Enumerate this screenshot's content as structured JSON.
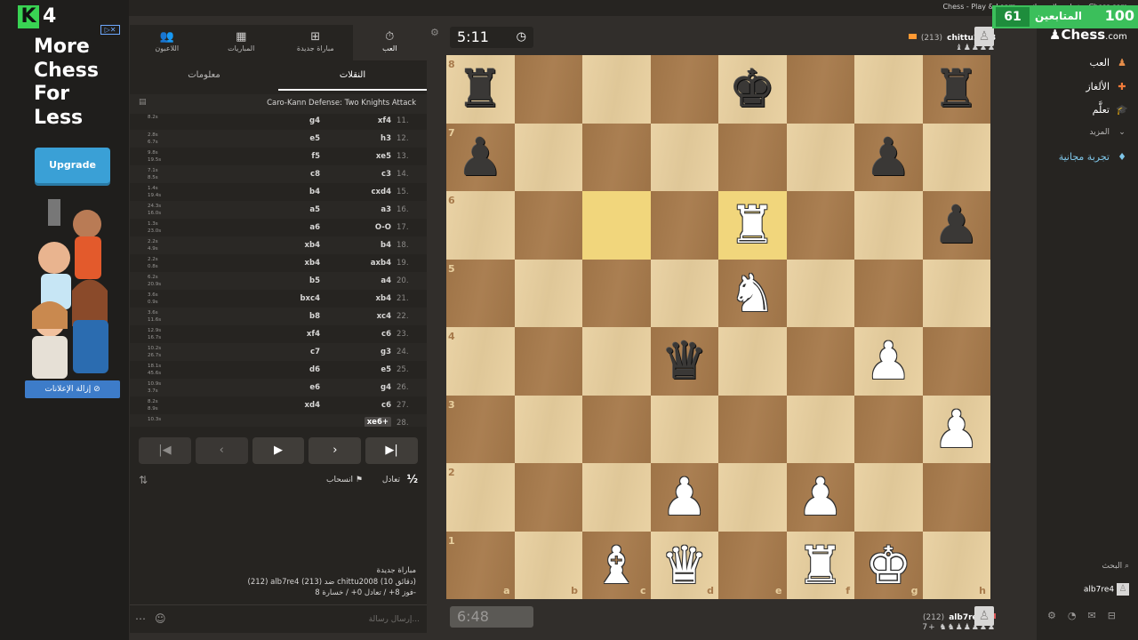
{
  "window": {
    "title": "Chess - Play & Learn - شطرنج لاعبين اثنين - Chess.com"
  },
  "ad": {
    "badge_letter": "K",
    "badge_number": "4",
    "headline": "More\nChess\nFor\nLess",
    "upgrade_label": "Upgrade",
    "remove_ads_label": "إزالة الإعلانات"
  },
  "topnav": [
    {
      "label": "العب",
      "icon": "stopwatch-icon"
    },
    {
      "label": "مباراة جديدة",
      "icon": "plus-icon"
    },
    {
      "label": "المباريات",
      "icon": "board-icon"
    },
    {
      "label": "اللاعبون",
      "icon": "people-icon"
    }
  ],
  "subtabs": [
    "النقلات",
    "معلومات"
  ],
  "opening": "Caro-Kann Defense: Two Knights Attack",
  "moves": [
    {
      "n": "11.",
      "w": "xf4",
      "b": "g4",
      "t1": "8.2s",
      "t2": ""
    },
    {
      "n": "12.",
      "w": "h3",
      "b": "e5",
      "t1": "2.8s",
      "t2": "6.7s"
    },
    {
      "n": "13.",
      "w": "xe5",
      "b": "f5",
      "t1": "9.8s",
      "t2": "19.5s"
    },
    {
      "n": "14.",
      "w": "c3",
      "b": "c8",
      "t1": "7.1s",
      "t2": "8.5s"
    },
    {
      "n": "15.",
      "w": "cxd4",
      "b": "b4",
      "t1": "1.4s",
      "t2": "19.4s"
    },
    {
      "n": "16.",
      "w": "a3",
      "b": "a5",
      "t1": "24.3s",
      "t2": "16.0s"
    },
    {
      "n": "17.",
      "w": "O-O",
      "b": "a6",
      "t1": "1.3s",
      "t2": "23.0s"
    },
    {
      "n": "18.",
      "w": "b4",
      "b": "xb4",
      "t1": "2.2s",
      "t2": "4.9s"
    },
    {
      "n": "19.",
      "w": "axb4",
      "b": "xb4",
      "t1": "2.2s",
      "t2": "0.8s"
    },
    {
      "n": "20.",
      "w": "a4",
      "b": "b5",
      "t1": "6.2s",
      "t2": "20.9s"
    },
    {
      "n": "21.",
      "w": "xb4",
      "b": "bxc4",
      "t1": "3.6s",
      "t2": "0.9s"
    },
    {
      "n": "22.",
      "w": "xc4",
      "b": "b8",
      "t1": "3.6s",
      "t2": "11.6s"
    },
    {
      "n": "23.",
      "w": "c6",
      "b": "xf4",
      "t1": "12.9s",
      "t2": "16.7s"
    },
    {
      "n": "24.",
      "w": "g3",
      "b": "c7",
      "t1": "10.2s",
      "t2": "26.7s"
    },
    {
      "n": "25.",
      "w": "e5",
      "b": "d6",
      "t1": "18.1s",
      "t2": "45.6s"
    },
    {
      "n": "26.",
      "w": "g4",
      "b": "e6",
      "t1": "10.9s",
      "t2": "3.7s"
    },
    {
      "n": "27.",
      "w": "c6",
      "b": "xd4",
      "t1": "8.2s",
      "t2": "8.9s"
    },
    {
      "n": "28.",
      "w": "xe6+",
      "b": "",
      "t1": "10.3s",
      "t2": ""
    }
  ],
  "controls": [
    "first",
    "prev",
    "play",
    "next",
    "last"
  ],
  "actions": {
    "half": "½",
    "draw": "تعادل",
    "resign": "انسحاب"
  },
  "chat": {
    "line1": "مباراة جديدة",
    "line2": "(212) alb7re4 ضد (213) chittu2008 (10 دقائق)",
    "line3": "فوز 8+ / تعادل 0+ / خسارة 8-",
    "placeholder": "إرسال رسالة..."
  },
  "top_player": {
    "name": "chittu2008",
    "rating": "(213)",
    "clock": "5:11",
    "captured": "♝♟♟♟♟"
  },
  "bottom_player": {
    "name": "alb7re4",
    "rating": "(212)",
    "clock": "6:48",
    "captured": "7+ ♞♞♟♟♟♟♟"
  },
  "followers": {
    "count_left": "61",
    "label": "المتابعين",
    "count_right": "100"
  },
  "brand": {
    "name": "Chess",
    "suffix": ".com"
  },
  "rightnav": [
    {
      "label": "العب",
      "icon": "pawn-icon"
    },
    {
      "label": "الألغاز",
      "icon": "puzzle-icon"
    },
    {
      "label": "تعلَّم",
      "icon": "graduation-cap-icon"
    },
    {
      "label": "المزيد",
      "icon": "chevron-down-icon"
    },
    {
      "label": "تجربة مجانية",
      "icon": "diamond-icon"
    }
  ],
  "search_label": "البحث",
  "me_label": "alb7re4",
  "board": {
    "files": [
      "a",
      "b",
      "c",
      "d",
      "e",
      "f",
      "g",
      "h"
    ],
    "ranks": [
      "8",
      "7",
      "6",
      "5",
      "4",
      "3",
      "2",
      "1"
    ],
    "highlight": [
      "c6",
      "e6"
    ],
    "pieces": [
      {
        "sq": "a8",
        "p": "♜",
        "c": "b"
      },
      {
        "sq": "e8",
        "p": "♚",
        "c": "b"
      },
      {
        "sq": "h8",
        "p": "♜",
        "c": "b"
      },
      {
        "sq": "a7",
        "p": "♟",
        "c": "b"
      },
      {
        "sq": "g7",
        "p": "♟",
        "c": "b"
      },
      {
        "sq": "h6",
        "p": "♟",
        "c": "b"
      },
      {
        "sq": "e6",
        "p": "♜",
        "c": "w"
      },
      {
        "sq": "e5",
        "p": "♞",
        "c": "w"
      },
      {
        "sq": "d4",
        "p": "♛",
        "c": "b"
      },
      {
        "sq": "g4",
        "p": "♟",
        "c": "w"
      },
      {
        "sq": "h3",
        "p": "♟",
        "c": "w"
      },
      {
        "sq": "d2",
        "p": "♟",
        "c": "w"
      },
      {
        "sq": "f2",
        "p": "♟",
        "c": "w"
      },
      {
        "sq": "c1",
        "p": "♝",
        "c": "w"
      },
      {
        "sq": "d1",
        "p": "♛",
        "c": "w"
      },
      {
        "sq": "f1",
        "p": "♜",
        "c": "w"
      },
      {
        "sq": "g1",
        "p": "♚",
        "c": "w"
      }
    ]
  }
}
